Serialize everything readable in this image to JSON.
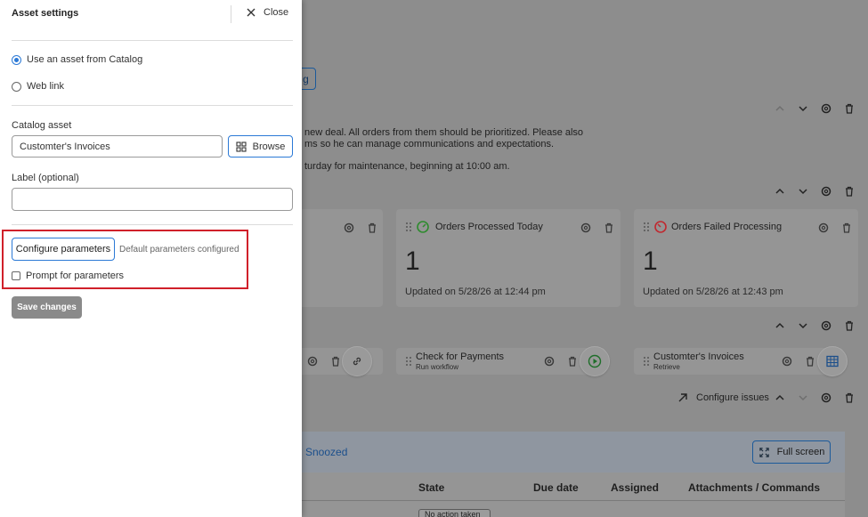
{
  "drawer": {
    "title": "Asset settings",
    "close_label": "Close",
    "source_options": [
      {
        "label": "Use an asset from Catalog",
        "selected": true
      },
      {
        "label": "Web link",
        "selected": false
      }
    ],
    "catalog_asset_label": "Catalog asset",
    "catalog_asset_value": "Customter's Invoices",
    "browse_label": "Browse",
    "label_field_label": "Label (optional)",
    "label_field_value": "",
    "configure_button": "Configure parameters",
    "configure_note": "Default parameters configured",
    "prompt_checkbox_label": "Prompt for parameters",
    "prompt_checked": false,
    "save_label": "Save changes"
  },
  "background": {
    "top_button_fragment": "g",
    "message_lines": [
      "new deal. All orders from them should be prioritized. Please also",
      "ms so he can manage communications and expectations.",
      "turday for maintenance, beginning at 10:00 am."
    ],
    "metric_cards": [
      {
        "title": "Orders Processed Today",
        "value": "1",
        "updated": "Updated on 5/28/26 at 12:44 pm"
      },
      {
        "title": "Orders Failed Processing",
        "value": "1",
        "updated": "Updated on 5/28/26 at 12:43 pm"
      }
    ],
    "workflow_cards": [
      {
        "title": "Check for Payments",
        "subtitle": "Run workflow"
      },
      {
        "title": "Customter's Invoices",
        "subtitle": "Retrieve"
      }
    ],
    "configure_issues_label": "Configure issues",
    "snoozed_tab": "Snoozed",
    "full_screen_label": "Full screen",
    "table_headers": [
      "State",
      "Due date",
      "Assigned",
      "Attachments / Commands"
    ],
    "state_cell_fragment": "No action taken"
  },
  "colors": {
    "accent": "#2b79d6",
    "highlight": "#d0202a",
    "success_gauge": "#2e8b2e",
    "failure_gauge": "#c0282f"
  }
}
